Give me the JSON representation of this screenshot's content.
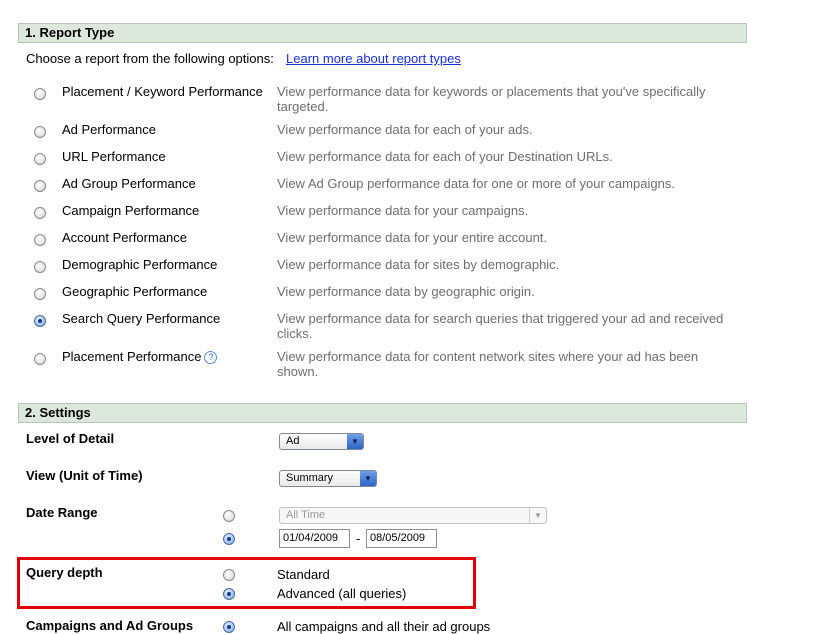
{
  "report_type": {
    "header": "1. Report Type",
    "intro": "Choose a report from the following options:",
    "learn_more": "Learn more about report types",
    "options": [
      {
        "label": "Placement / Keyword Performance",
        "description": "View performance data for keywords or placements that you've specifically targeted.",
        "selected": false
      },
      {
        "label": "Ad Performance",
        "description": "View performance data for each of your ads.",
        "selected": false
      },
      {
        "label": "URL Performance",
        "description": "View performance data for each of your Destination URLs.",
        "selected": false
      },
      {
        "label": "Ad Group Performance",
        "description": "View Ad Group performance data for one or more of your campaigns.",
        "selected": false
      },
      {
        "label": "Campaign Performance",
        "description": "View performance data for your campaigns.",
        "selected": false
      },
      {
        "label": "Account Performance",
        "description": "View performance data for your entire account.",
        "selected": false
      },
      {
        "label": "Demographic Performance",
        "description": "View performance data for sites by demographic.",
        "selected": false
      },
      {
        "label": "Geographic Performance",
        "description": "View performance data by geographic origin.",
        "selected": false
      },
      {
        "label": "Search Query Performance",
        "description": "View performance data for search queries that triggered your ad and received clicks.",
        "selected": true
      },
      {
        "label": "Placement Performance",
        "description": "View performance data for content network sites where your ad has been shown.",
        "selected": false
      }
    ],
    "help_icon": "question-icon"
  },
  "settings": {
    "header": "2. Settings",
    "level_of_detail": {
      "label": "Level of Detail",
      "value": "Ad"
    },
    "view": {
      "label": "View (Unit of Time)",
      "value": "Summary"
    },
    "date_range": {
      "label": "Date Range",
      "preset": "All Time",
      "start": "01/04/2009",
      "separator": "-",
      "end": "08/05/2009"
    },
    "query_depth": {
      "label": "Query depth",
      "options": [
        "Standard",
        "Advanced (all queries)"
      ],
      "selected_index": 1
    },
    "campaigns": {
      "label": "Campaigns and Ad Groups",
      "option": "All campaigns and all their ad groups"
    }
  },
  "colors": {
    "highlight": "#e0000b",
    "section_bg": "#dde8dd",
    "link": "#1a2ed0"
  }
}
